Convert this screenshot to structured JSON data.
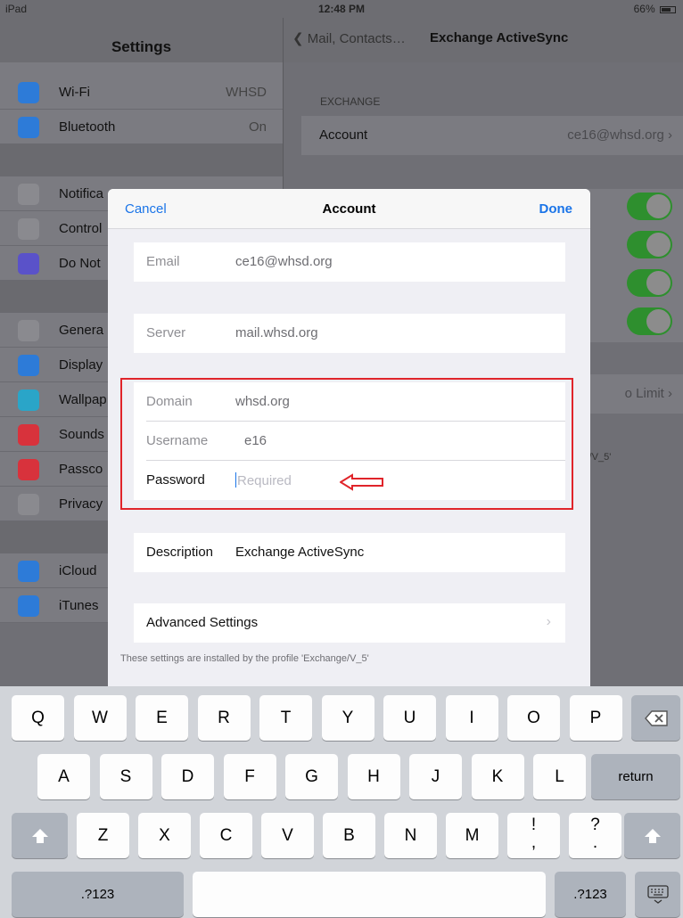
{
  "status_bar": {
    "device": "iPad",
    "time": "12:48 PM",
    "battery": "66%"
  },
  "sidebar": {
    "title": "Settings",
    "group1": [
      {
        "label": "Wi-Fi",
        "value": "WHSD",
        "icon": "wifi-icon",
        "color": "#2d7bd8"
      },
      {
        "label": "Bluetooth",
        "value": "On",
        "icon": "bluetooth-icon",
        "color": "#2d7bd8"
      }
    ],
    "group2": [
      {
        "label": "Notifica",
        "icon": "notifications-icon",
        "color": "#8a8a8f"
      },
      {
        "label": "Control",
        "icon": "control-center-icon",
        "color": "#8a8a8f"
      },
      {
        "label": "Do Not",
        "icon": "moon-icon",
        "color": "#5a52c9"
      }
    ],
    "group3": [
      {
        "label": "Genera",
        "icon": "gear-icon",
        "color": "#8a8a8f"
      },
      {
        "label": "Display",
        "icon": "display-icon",
        "color": "#2d7bd8"
      },
      {
        "label": "Wallpap",
        "icon": "wallpaper-icon",
        "color": "#2aa5c8"
      },
      {
        "label": "Sounds",
        "icon": "speaker-icon",
        "color": "#d8323c"
      },
      {
        "label": "Passco",
        "icon": "lock-icon",
        "color": "#d8323c"
      },
      {
        "label": "Privacy",
        "icon": "hand-icon",
        "color": "#8a8a8f"
      }
    ],
    "group4": [
      {
        "label": "iCloud",
        "icon": "cloud-icon",
        "color": "#2d7bd8"
      },
      {
        "label": "iTunes",
        "icon": "app-store-icon",
        "color": "#2d7bd8"
      }
    ]
  },
  "detail": {
    "back_label": "Mail, Contacts…",
    "title": "Exchange ActiveSync",
    "section_header": "EXCHANGE",
    "account_label": "Account",
    "account_value": "ce16@whsd.org",
    "mail_days_value": "o Limit",
    "profile_note": "ie/V_5'"
  },
  "modal": {
    "cancel_label": "Cancel",
    "title": "Account",
    "done_label": "Done",
    "email": {
      "label": "Email",
      "value": "ce16@whsd.org"
    },
    "server": {
      "label": "Server",
      "value": "mail.whsd.org"
    },
    "domain": {
      "label": "Domain",
      "value": "whsd.org"
    },
    "username": {
      "label": "Username",
      "value": "e16"
    },
    "password": {
      "label": "Password",
      "placeholder": "Required"
    },
    "description": {
      "label": "Description",
      "value": "Exchange ActiveSync"
    },
    "advanced_label": "Advanced Settings",
    "footnote": "These settings are installed by the profile 'Exchange/V_5'"
  },
  "keyboard": {
    "row1": [
      "Q",
      "W",
      "E",
      "R",
      "T",
      "Y",
      "U",
      "I",
      "O",
      "P"
    ],
    "row2": [
      "A",
      "S",
      "D",
      "F",
      "G",
      "H",
      "J",
      "K",
      "L"
    ],
    "row3": [
      "Z",
      "X",
      "C",
      "V",
      "B",
      "N",
      "M",
      "!\n,",
      "?\n."
    ],
    "return_label": "return",
    "numbers_label": ".?123"
  },
  "colors": {
    "accent": "#1a74e8",
    "highlight": "#e0242a",
    "toggle_on": "#2e8f2e"
  }
}
